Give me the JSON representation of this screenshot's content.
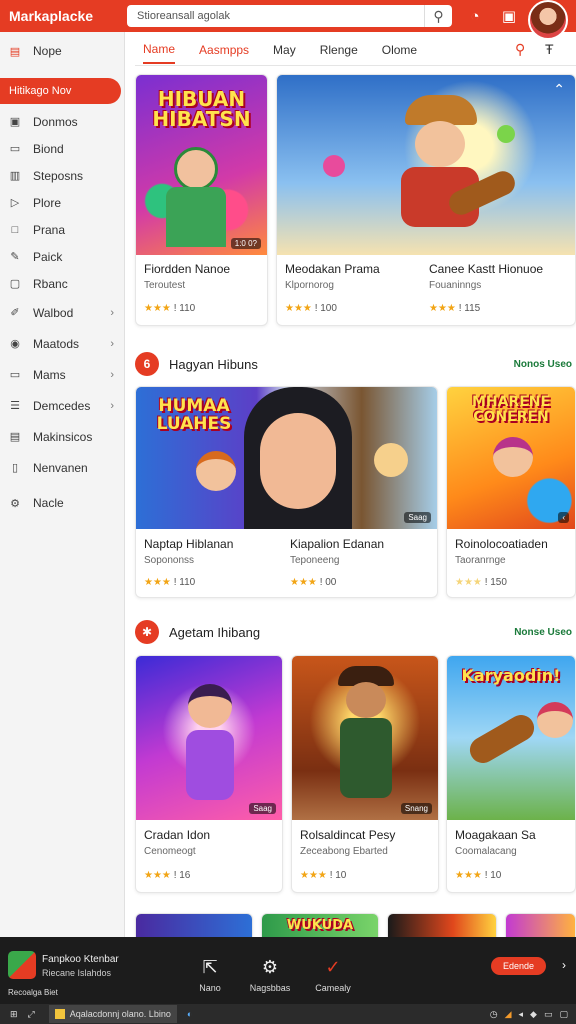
{
  "app": {
    "title": "Markaplacke"
  },
  "search": {
    "placeholder": "Stioreansall agolak"
  },
  "sidebar": {
    "top": {
      "label": "Nope"
    },
    "active": {
      "label": "Hitikago Nov"
    },
    "items": [
      {
        "label": "Donmos",
        "icon": "grid-icon"
      },
      {
        "label": "Biond",
        "icon": "monitor-icon"
      },
      {
        "label": "Steposns",
        "icon": "clipboard-icon"
      },
      {
        "label": "Plore",
        "icon": "play-icon"
      },
      {
        "label": "Prana",
        "icon": "window-icon"
      },
      {
        "label": "Paick",
        "icon": "edit-icon"
      },
      {
        "label": "Rbanc",
        "icon": "box-icon"
      },
      {
        "label": "Walbod",
        "icon": "pencil-icon",
        "chevron": true
      },
      {
        "label": "Maatods",
        "icon": "target-icon",
        "chevron": true
      },
      {
        "label": "Mams",
        "icon": "chat-icon",
        "chevron": true
      },
      {
        "label": "Demcedes",
        "icon": "list-icon",
        "chevron": true
      },
      {
        "label": "Makinsicos",
        "icon": "store-icon"
      },
      {
        "label": "Nenvanen",
        "icon": "file-icon"
      },
      {
        "label": "Nacle",
        "icon": "gear-icon"
      }
    ]
  },
  "tabs": [
    "Name",
    "Aasmpps",
    "May",
    "Rlenge",
    "Olome"
  ],
  "featured": [
    {
      "title": "Fiordden Nanoe",
      "subtitle": "Teroutest",
      "rating": "★★★",
      "count": "! 110",
      "art_text": "HIBUAN HIBATSN",
      "badge": "1:0 0?"
    },
    {
      "title": "Meodakan Prama",
      "subtitle": "Klpornorog",
      "rating": "★★★",
      "count": "! 100"
    },
    {
      "title": "Canee Kastt Hionuoe",
      "subtitle": "Fouaninngs",
      "rating": "★★★",
      "count": "! 115"
    }
  ],
  "section1": {
    "icon": "6",
    "title": "Hagyan Hibuns",
    "more": "Nonos Useo",
    "cards": [
      {
        "title": "Naptap Hiblanan",
        "subtitle": "Sopononss",
        "rating": "★★★",
        "count": "! 110",
        "art_text": "HUMAA LUAHES",
        "badge": "Saag"
      },
      {
        "title": "Kiapalion Edanan",
        "subtitle": "Teponeeng",
        "rating": "★★★",
        "count": "! 00"
      },
      {
        "title": "Roinolocoatiaden",
        "subtitle": "Taoranrnge",
        "rating": "★★★",
        "count": "! 150",
        "art_text": "MHARENE CONEREN"
      }
    ]
  },
  "section2": {
    "icon": "✱",
    "title": "Agetam Ihibang",
    "more": "Nonse Useo",
    "cards": [
      {
        "title": "Cradan Idon",
        "subtitle": "Cenomeogt",
        "rating": "★★★",
        "count": "! 16",
        "badge": "Saag"
      },
      {
        "title": "Rolsaldincat Pesy",
        "subtitle": "Zeceabong Ebarted",
        "rating": "★★★",
        "count": "! 10",
        "badge": "Snang"
      },
      {
        "title": "Moagakaan Sa",
        "subtitle": "Coomalacang",
        "rating": "★★★",
        "count": "! 10",
        "art_text": "Karyaodin!"
      }
    ]
  },
  "strip": {
    "art_text": "WUKUDA"
  },
  "bottombar": {
    "line1": "Fanpkoo Ktenbar",
    "line2": "Riecane Islahdos",
    "line3": "Recoalga Biet",
    "nav": [
      {
        "label": "Nano",
        "icon": "send-icon"
      },
      {
        "label": "Nagsbbas",
        "icon": "gear-icon"
      },
      {
        "label": "Camealy",
        "icon": "check-icon"
      }
    ],
    "button": "Edende"
  },
  "taskbar": {
    "active": "Aqalacdonnj olano. Lbino"
  },
  "colors": {
    "accent": "#e53c23",
    "link": "#1a7a3a",
    "star": "#f2a516"
  }
}
